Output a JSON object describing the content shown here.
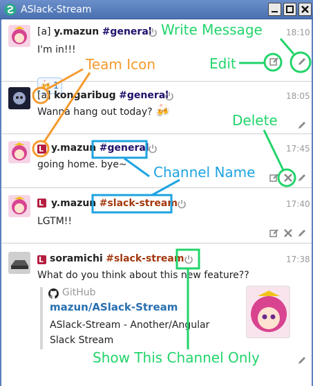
{
  "window": {
    "title": "ASlack-Stream"
  },
  "messages": [
    {
      "team_tag": "[a]",
      "user": "y.mazun",
      "channel": "#general",
      "time": "18:10",
      "text": "I'm in!!!",
      "reaction": {
        "emoji": "🍻",
        "count": "1"
      }
    },
    {
      "team_tag": "[a]",
      "user": "kongaribug",
      "channel": "#general",
      "time": "18:05",
      "text": "Wanna hang out today?",
      "emoji": "🍻"
    },
    {
      "user": "y.mazun",
      "channel": "#general",
      "time": "17:45",
      "text": "going home. bye~"
    },
    {
      "user": "y.mazun",
      "channel": "#slack-stream",
      "time": "17:40",
      "text": "LGTM!!"
    },
    {
      "user": "soramichi",
      "channel": "#slack-stream",
      "time": "17:38",
      "text": "What do you think about this new feature??",
      "attachment": {
        "service": "GitHub",
        "title": "mazun/ASlack-Stream",
        "body": "ASlack-Stream - Another/Angular Slack Stream"
      }
    }
  ],
  "annotations": {
    "write_message": "Write Message",
    "edit": "Edit",
    "team_icon": "Team Icon",
    "delete": "Delete",
    "channel_name": "Channel Name",
    "show_channel_only": "Show This Channel Only"
  },
  "colors": {
    "annotation_green": "#22d46a",
    "annotation_orange": "#f59a2e",
    "annotation_blue": "#1ea3e0",
    "team_icon": "#b51e40"
  }
}
